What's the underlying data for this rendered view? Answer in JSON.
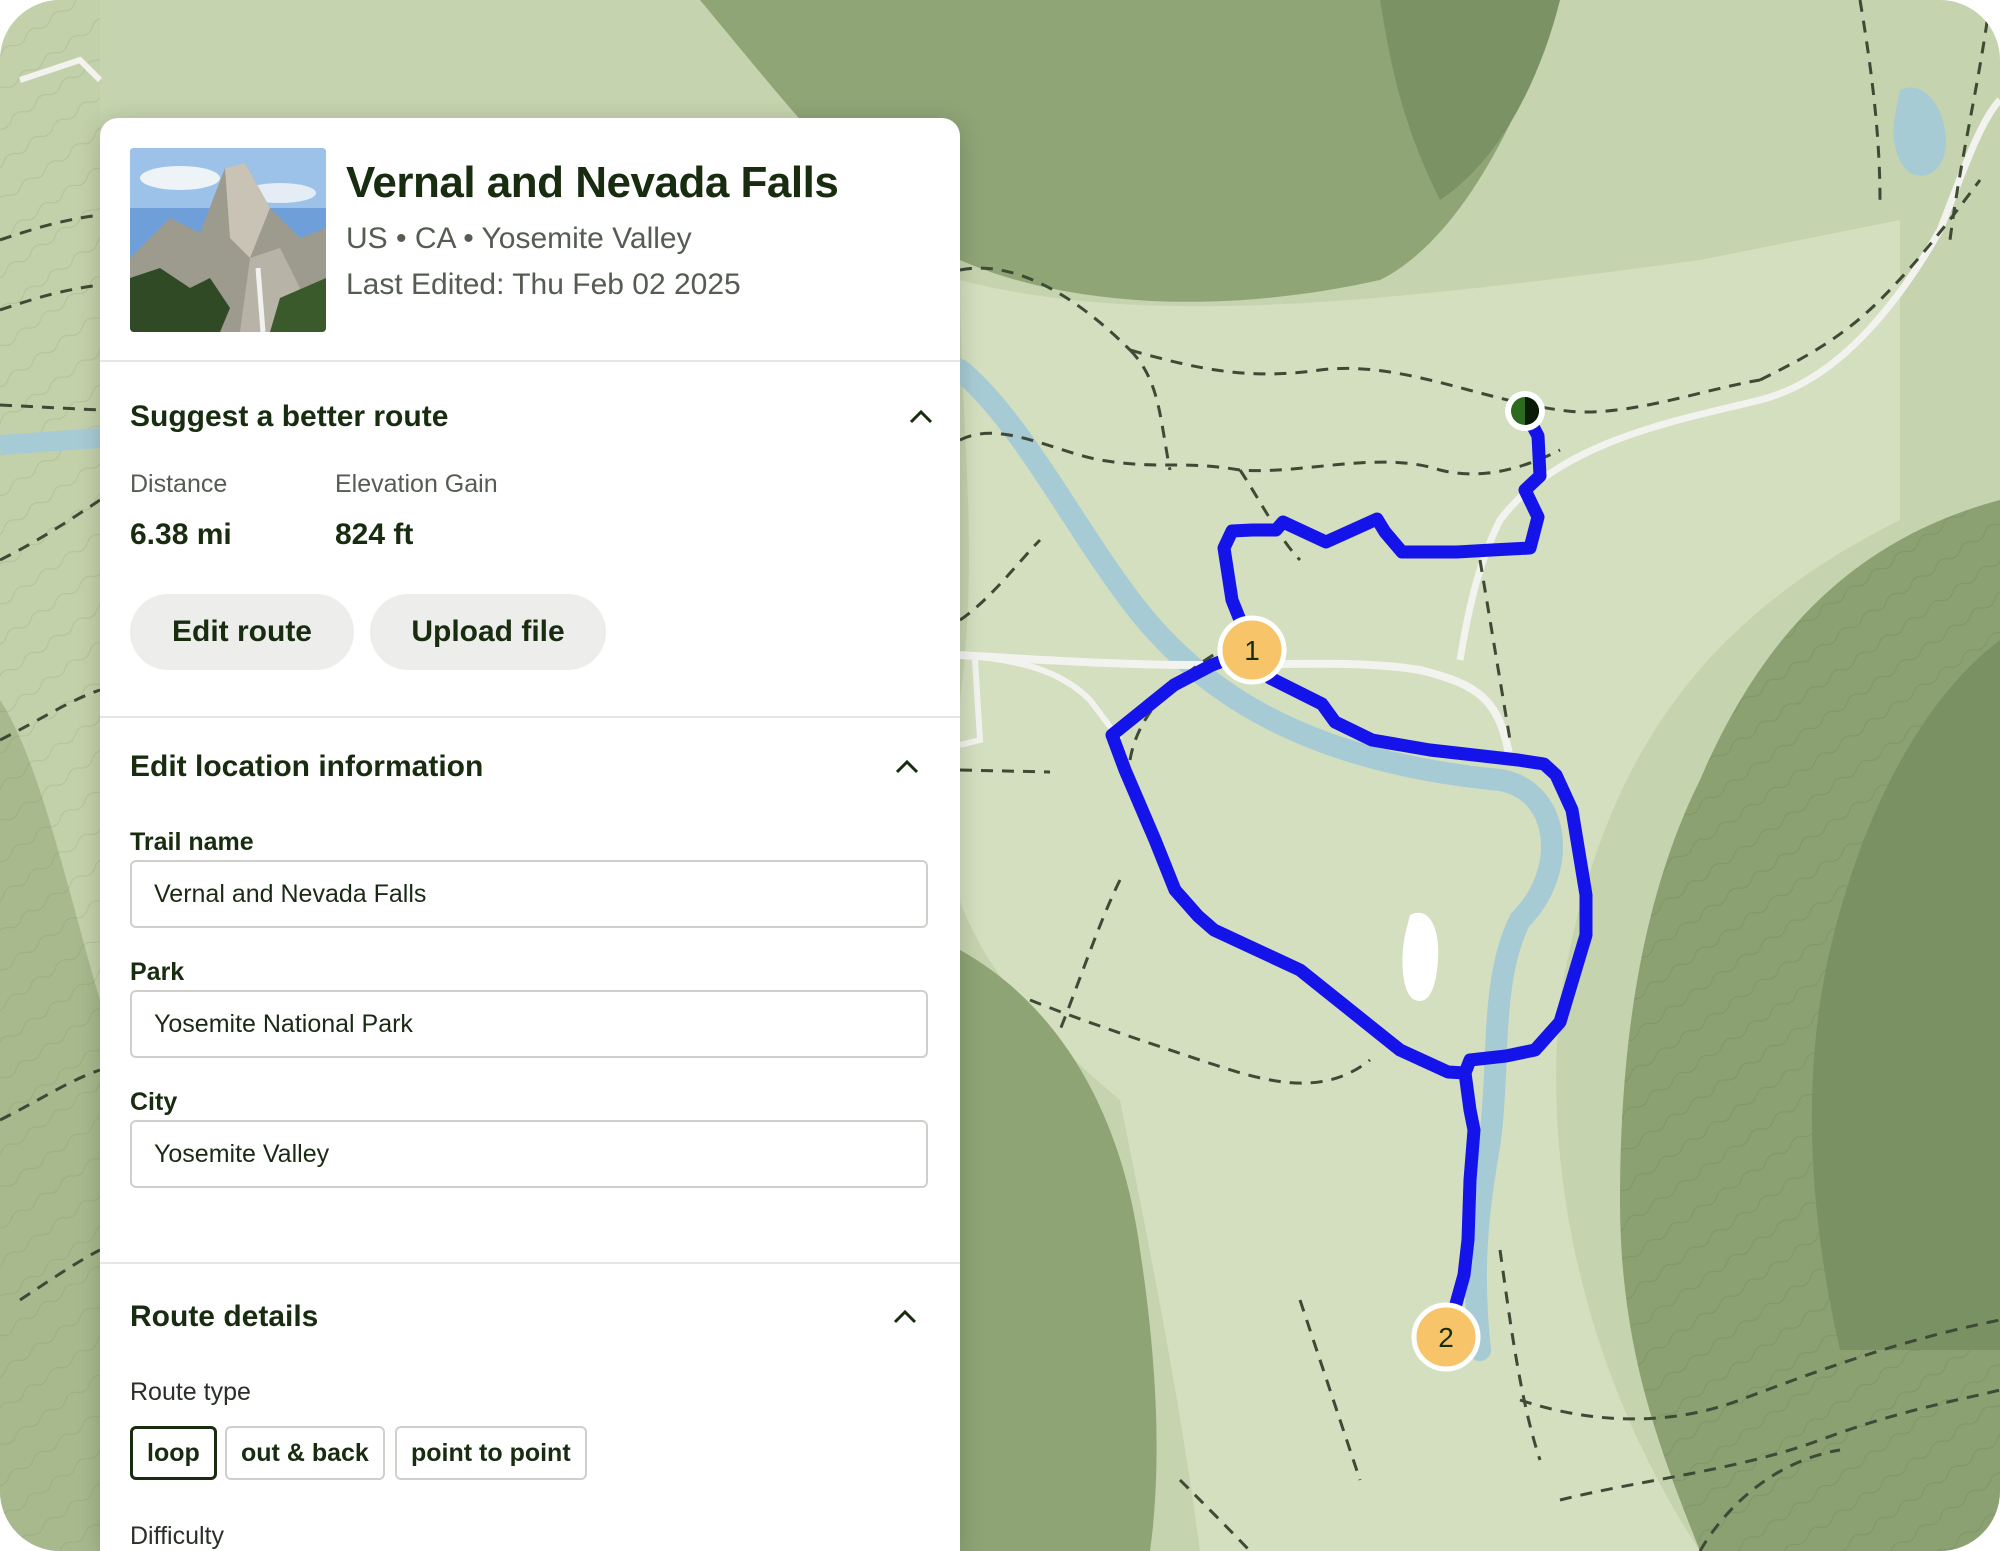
{
  "trail": {
    "title": "Vernal and Nevada Falls",
    "location_line": "US • CA • Yosemite Valley",
    "last_edited": "Last Edited: Thu Feb 02 2025"
  },
  "suggest": {
    "heading": "Suggest a better route",
    "distance_label": "Distance",
    "distance_value": "6.38 mi",
    "elevation_label": "Elevation Gain",
    "elevation_value": "824 ft",
    "edit_button": "Edit route",
    "upload_button": "Upload file"
  },
  "location_info": {
    "heading": "Edit location information",
    "trail_name_label": "Trail name",
    "trail_name_value": "Vernal and Nevada Falls",
    "park_label": "Park",
    "park_value": "Yosemite National Park",
    "city_label": "City",
    "city_value": "Yosemite Valley"
  },
  "route_details": {
    "heading": "Route details",
    "route_type_label": "Route type",
    "route_types": [
      "loop",
      "out & back",
      "point to point"
    ],
    "selected_route_type": "loop",
    "difficulty_label": "Difficulty"
  },
  "map": {
    "waypoints": [
      "1",
      "2"
    ],
    "route_color": "#1a1aeb",
    "waypoint_color": "#f7c46a",
    "start_marker_color": "#2d6a1f",
    "terrain_color": "#c9d6b3",
    "water_color": "#a8ccd6"
  },
  "icons": {
    "section_toggle": "chevron-up-icon",
    "trail_photo": "mountain-photo"
  }
}
